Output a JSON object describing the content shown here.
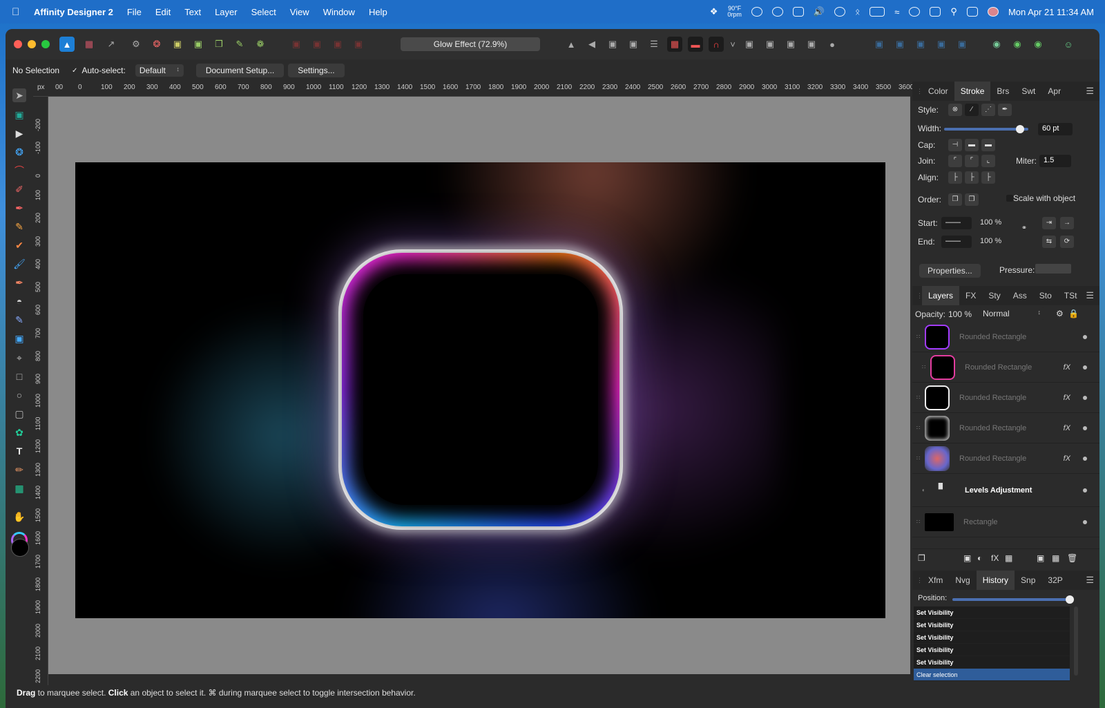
{
  "menubar": {
    "app_name": "Affinity Designer 2",
    "items": [
      "File",
      "Edit",
      "Text",
      "Layer",
      "Select",
      "View",
      "Window",
      "Help"
    ],
    "weather_temp": "90°F",
    "weather_sub": "0rpm",
    "datetime": "Mon Apr 21  11:34 AM"
  },
  "document": {
    "title": "Glow Effect (72.9%)"
  },
  "contextbar": {
    "selection": "No Selection",
    "auto_select_label": "Auto-select:",
    "auto_select_value": "Default",
    "document_setup": "Document Setup...",
    "settings": "Settings..."
  },
  "ruler": {
    "unit": "px",
    "top_labels": [
      "00",
      "0",
      "100",
      "200",
      "300",
      "400",
      "500",
      "600",
      "700",
      "800",
      "900",
      "1000",
      "1100",
      "1200",
      "1300",
      "1400",
      "1500",
      "1600",
      "1700",
      "1800",
      "1900",
      "2000",
      "2100",
      "2200",
      "2300",
      "2400",
      "2500",
      "2600",
      "2700",
      "2800",
      "2900",
      "3000",
      "3100",
      "3200",
      "3300",
      "3400",
      "3500",
      "3600"
    ],
    "left_labels": [
      "-200",
      "-100",
      "0",
      "100",
      "200",
      "300",
      "400",
      "500",
      "600",
      "700",
      "800",
      "900",
      "1000",
      "1100",
      "1200",
      "1300",
      "1400",
      "1500",
      "1600",
      "1700",
      "1800",
      "1900",
      "2000",
      "2100",
      "2200"
    ]
  },
  "stroke_panel": {
    "tabs": [
      "Color",
      "Stroke",
      "Brs",
      "Swt",
      "Apr"
    ],
    "active_tab": "Stroke",
    "style_label": "Style:",
    "width_label": "Width:",
    "width_value": "60 pt",
    "width_fraction": 0.9,
    "cap_label": "Cap:",
    "join_label": "Join:",
    "miter_label": "Miter:",
    "miter_value": "1.5",
    "align_label": "Align:",
    "order_label": "Order:",
    "scale_label": "Scale with object",
    "start_label": "Start:",
    "start_value": "100 %",
    "end_label": "End:",
    "end_value": "100 %",
    "properties": "Properties...",
    "pressure_label": "Pressure:"
  },
  "layers_panel": {
    "tabs": [
      "Layers",
      "FX",
      "Sty",
      "Ass",
      "Sto",
      "TSt"
    ],
    "active_tab": "Layers",
    "opacity_label": "Opacity:",
    "opacity_value": "100 %",
    "blend_mode": "Normal",
    "layers": [
      {
        "name": "Rounded Rectangle",
        "fx": "",
        "strong": false
      },
      {
        "name": "Rounded Rectangle",
        "fx": "fX",
        "strong": false
      },
      {
        "name": "Rounded Rectangle",
        "fx": "fX",
        "strong": false
      },
      {
        "name": "Rounded Rectangle",
        "fx": "fX",
        "strong": false
      },
      {
        "name": "Rounded Rectangle",
        "fx": "fX",
        "strong": false
      },
      {
        "name": "Levels Adjustment",
        "fx": "",
        "strong": true
      },
      {
        "name": "Rectangle",
        "fx": "",
        "strong": false
      }
    ]
  },
  "history_panel": {
    "tabs": [
      "Xfm",
      "Nvg",
      "History",
      "Snp",
      "32P"
    ],
    "active_tab": "History",
    "position_label": "Position:",
    "position_fraction": 1.0,
    "items": [
      "Set Visibility",
      "Set Visibility",
      "Set Visibility",
      "Set Visibility",
      "Set Visibility",
      "Clear selection"
    ]
  },
  "statusbar": {
    "drag": "Drag",
    "drag_text": " to marquee select. ",
    "click": "Click",
    "click_text": " an object to select it. ⌘ during marquee select to toggle intersection behavior."
  },
  "colors": {
    "accent": "#2f5d9a",
    "menubar": "#1f6ec8"
  }
}
